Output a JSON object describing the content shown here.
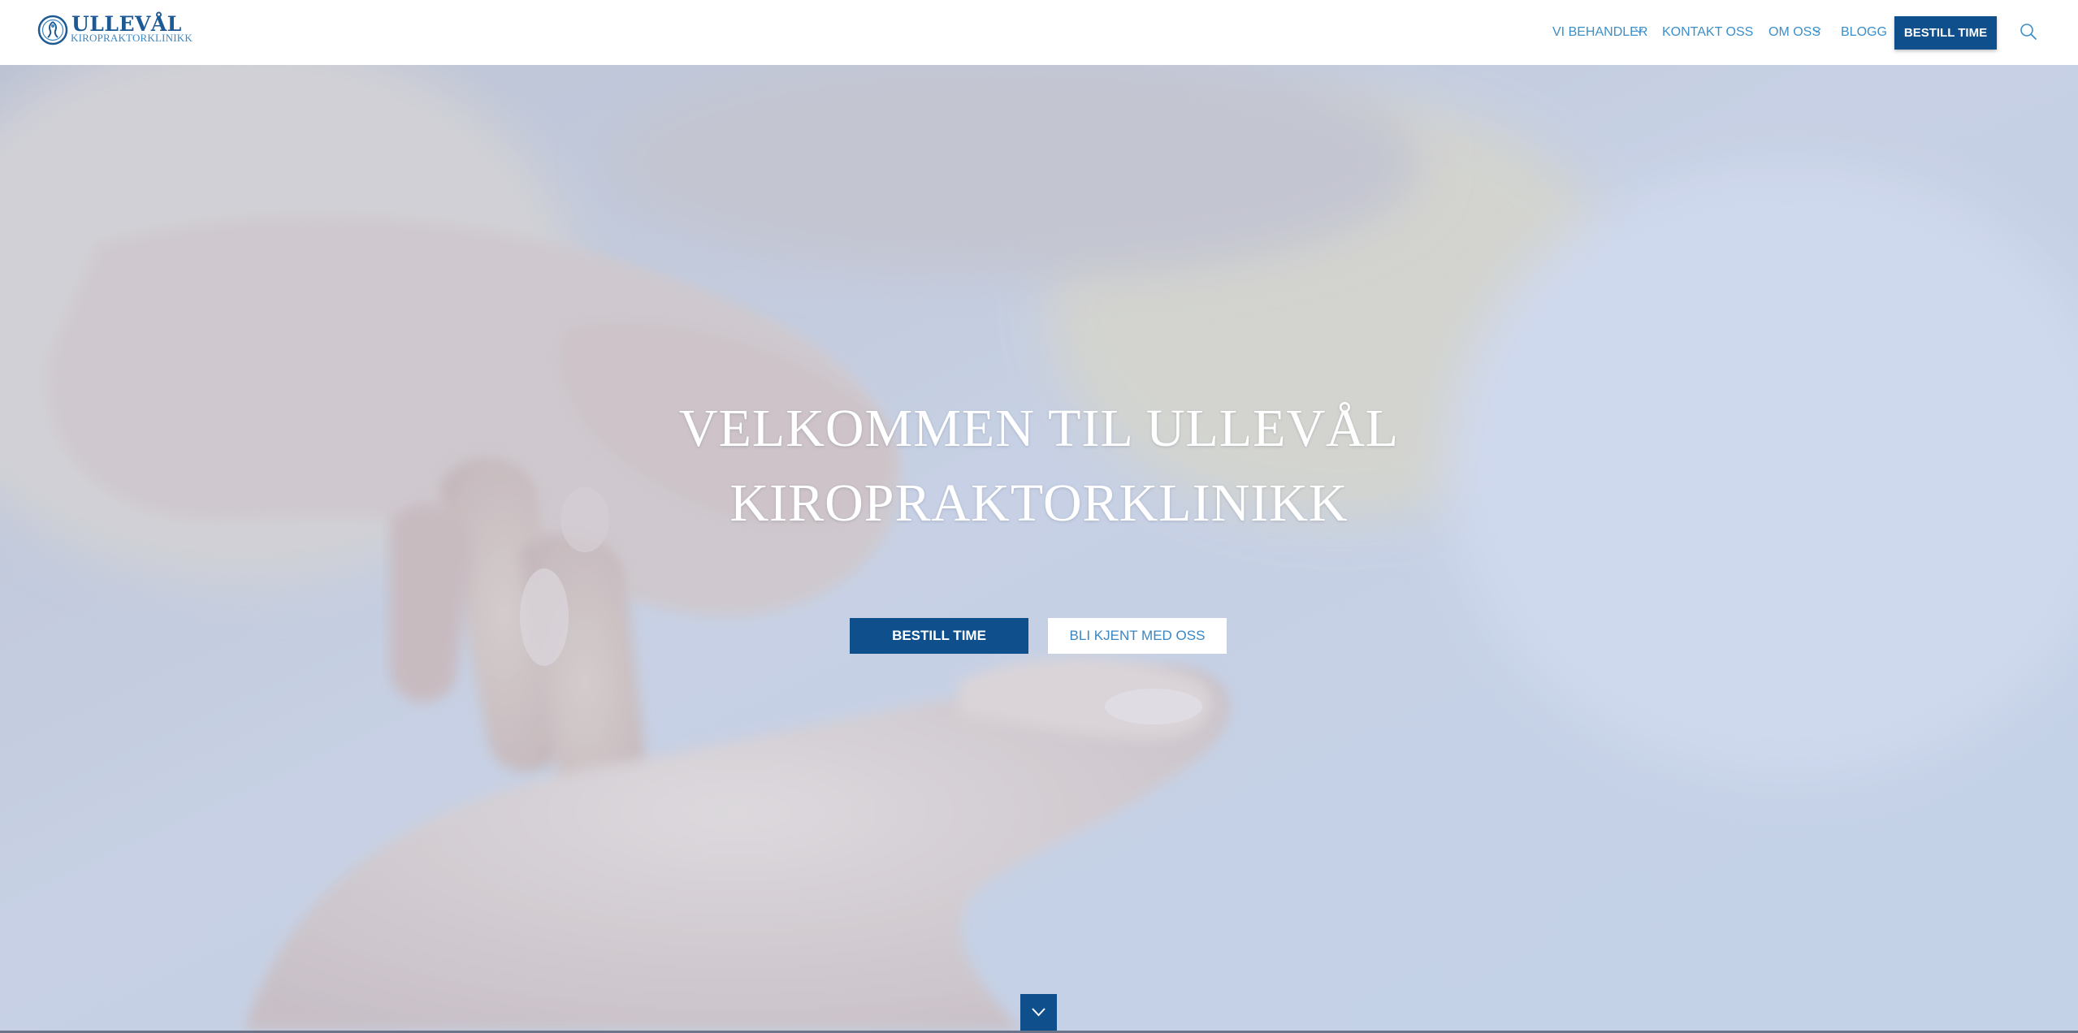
{
  "header": {
    "logo": {
      "name": "ULLEVÅL",
      "subtitle": "KIROPRAKTORKLINIKK"
    },
    "nav": [
      {
        "label": "VI BEHANDLER",
        "has_dropdown": true
      },
      {
        "label": "KONTAKT OSS",
        "has_dropdown": false
      },
      {
        "label": "OM OSS",
        "has_dropdown": true
      },
      {
        "label": "BLOGG",
        "has_dropdown": false
      }
    ],
    "cta_label": "BESTILL TIME",
    "search_icon": "search-icon"
  },
  "hero": {
    "title_line1": "VELKOMMEN TIL ULLEVÅL",
    "title_line2": "KIROPRAKTORKLINIKK",
    "primary_button": "BESTILL TIME",
    "secondary_button": "BLI KJENT MED OSS",
    "scroll_icon": "chevron-down-icon"
  },
  "colors": {
    "brand": "#0e4f8c",
    "nav_text": "#3b8fc9",
    "logo_text": "#1d5a93"
  }
}
